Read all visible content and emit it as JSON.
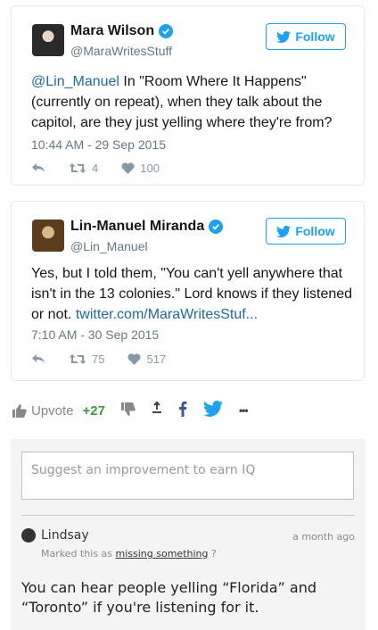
{
  "tweets": [
    {
      "name": "Mara Wilson",
      "handle": "@MaraWritesStuff",
      "follow_label": "Follow",
      "mention": "@Lin_Manuel",
      "text_rest": " In \"Room Where It Happens\" (currently on repeat), when they talk about the capitol, are they just yelling where they're from?",
      "date": "10:44 AM - 29 Sep 2015",
      "retweets": "4",
      "likes": "100"
    },
    {
      "name": "Lin-Manuel Miranda",
      "handle": "@Lin_Manuel",
      "follow_label": "Follow",
      "text": "Yes, but I told them, \"You can't yell anywhere that isn't in the 13 colonies.\" Lord knows if they listened or not. ",
      "link": "twitter.com/MaraWritesStuf...",
      "date": "7:10 AM - 30 Sep 2015",
      "retweets": "75",
      "likes": "517"
    }
  ],
  "vote_bar": {
    "upvote_label": "Upvote",
    "score": "+27",
    "more": "•••"
  },
  "suggestion": {
    "placeholder": "Suggest an improvement to earn IQ"
  },
  "comment": {
    "user": "Lindsay",
    "time": "a month ago",
    "marked_prefix": "Marked this as ",
    "marked_tag": "missing something",
    "marked_suffix": " ?",
    "body": "You can hear people yelling “Florida” and “Toronto” if you're listening for it."
  },
  "colors": {
    "twitter_blue": "#1da1f2",
    "link": "#1b6aa5",
    "upvote_green": "#3c9a3c",
    "panel_bg": "#f4f4f4"
  },
  "icons": [
    "verified-icon",
    "twitter-bird-icon",
    "reply-icon",
    "retweet-icon",
    "heart-icon",
    "thumbs-up-icon",
    "thumbs-down-icon",
    "reddit-icon",
    "facebook-icon",
    "twitter-share-icon",
    "more-icon",
    "user-icon"
  ]
}
